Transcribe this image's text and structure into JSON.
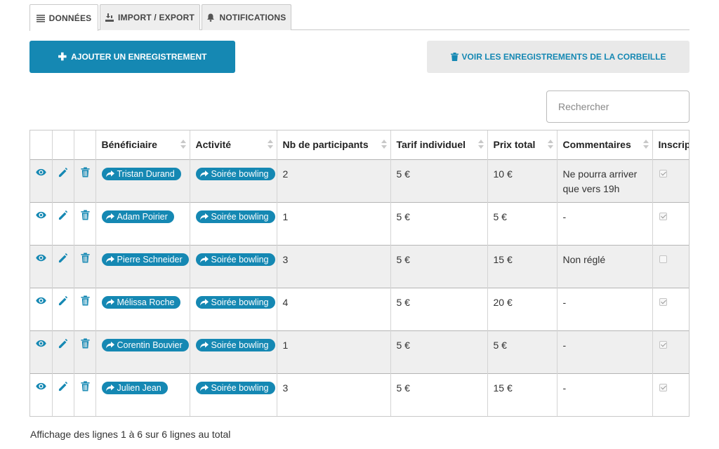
{
  "tabs": [
    {
      "label": "DONNÉES",
      "icon": "list-icon",
      "active": true
    },
    {
      "label": "IMPORT / EXPORT",
      "icon": "import-export-icon",
      "active": false
    },
    {
      "label": "NOTIFICATIONS",
      "icon": "bell-icon",
      "active": false
    }
  ],
  "toolbar": {
    "add_label": "AJOUTER UN ENREGISTREMENT",
    "trash_label": "VOIR LES ENREGISTREMENTS DE LA CORBEILLE"
  },
  "search": {
    "placeholder": "Rechercher",
    "value": ""
  },
  "table": {
    "columns": [
      "Bénéficiaire",
      "Activité",
      "Nb de participants",
      "Tarif individuel",
      "Prix total",
      "Commentaires",
      "Inscription"
    ],
    "rows": [
      {
        "beneficiaire": "Tristan Durand",
        "activite": "Soirée bowling",
        "nb": "2",
        "tarif": "5 €",
        "prix": "10 €",
        "commentaire": "Ne pourra arriver que vers 19h",
        "checked": true
      },
      {
        "beneficiaire": "Adam Poirier",
        "activite": "Soirée bowling",
        "nb": "1",
        "tarif": "5 €",
        "prix": "5 €",
        "commentaire": "-",
        "checked": true
      },
      {
        "beneficiaire": "Pierre Schneider",
        "activite": "Soirée bowling",
        "nb": "3",
        "tarif": "5 €",
        "prix": "15 €",
        "commentaire": "Non réglé",
        "checked": false
      },
      {
        "beneficiaire": "Mélissa Roche",
        "activite": "Soirée bowling",
        "nb": "4",
        "tarif": "5 €",
        "prix": "20 €",
        "commentaire": "-",
        "checked": true
      },
      {
        "beneficiaire": "Corentin Bouvier",
        "activite": "Soirée bowling",
        "nb": "1",
        "tarif": "5 €",
        "prix": "5 €",
        "commentaire": "-",
        "checked": true
      },
      {
        "beneficiaire": "Julien Jean",
        "activite": "Soirée bowling",
        "nb": "3",
        "tarif": "5 €",
        "prix": "15 €",
        "commentaire": "-",
        "checked": true
      }
    ]
  },
  "footer": {
    "text": "Affichage des lignes 1 à 6 sur 6 lignes au total"
  },
  "colors": {
    "accent": "#1588b3",
    "row_alt": "#efefef",
    "button_secondary": "#e9e9e9"
  }
}
